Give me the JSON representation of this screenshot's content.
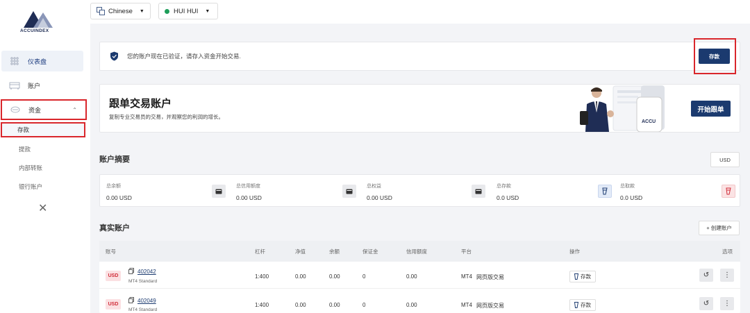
{
  "brand": {
    "name": "ACCUINDEX"
  },
  "sidebar": {
    "items": [
      {
        "label": "仪表盘",
        "icon": "dashboard-grid-icon"
      },
      {
        "label": "账户",
        "icon": "accounts-icon"
      },
      {
        "label": "资金",
        "icon": "funds-icon"
      }
    ],
    "sub_items": [
      "存款",
      "提款",
      "内部转账",
      "银行账户"
    ]
  },
  "topbar": {
    "language": "Chinese",
    "user": "HUI HUI"
  },
  "verify_banner": {
    "text": "您的账户现在已验证，请存入资金开始交易.",
    "deposit_label": "存款"
  },
  "copy_trading": {
    "title": "跟单交易账户",
    "desc": "复制专业交易员的交易，并观察您的利润的增长。",
    "start_label": "开始跟单",
    "phone_text": "ACCU"
  },
  "summary": {
    "title": "账户摘要",
    "currency_btn": "USD",
    "items": [
      {
        "label": "总余额",
        "value": "0.00 USD"
      },
      {
        "label": "总信用额度",
        "value": "0.00 USD"
      },
      {
        "label": "总权益",
        "value": "0.00 USD"
      },
      {
        "label": "总存款",
        "value": "0.0 USD"
      },
      {
        "label": "总取款",
        "value": "0.0 USD"
      }
    ]
  },
  "real_accounts": {
    "title": "真实账户",
    "create_label": "+ 创建账户",
    "headers": [
      "账号",
      "杠杆",
      "净值",
      "余额",
      "保证金",
      "信用额度",
      "平台",
      "操作",
      "选项"
    ],
    "rows": [
      {
        "currency": "USD",
        "account": "402042",
        "type": "MT4 Standard",
        "leverage": "1:400",
        "equity": "0.00",
        "balance": "0.00",
        "margin": "0",
        "credit": "0.00",
        "platform": "MT4",
        "web": "网页版交易",
        "action": "存款"
      },
      {
        "currency": "USD",
        "account": "402049",
        "type": "MT4 Standard",
        "leverage": "1:400",
        "equity": "0.00",
        "balance": "0.00",
        "margin": "0",
        "credit": "0.00",
        "platform": "MT4",
        "web": "网页版交易",
        "action": "存款"
      }
    ]
  },
  "colors": {
    "primary": "#1b3a6f",
    "highlight": "#d9262b",
    "badge_bg": "#fbe0e2",
    "badge_text": "#d02a36"
  }
}
